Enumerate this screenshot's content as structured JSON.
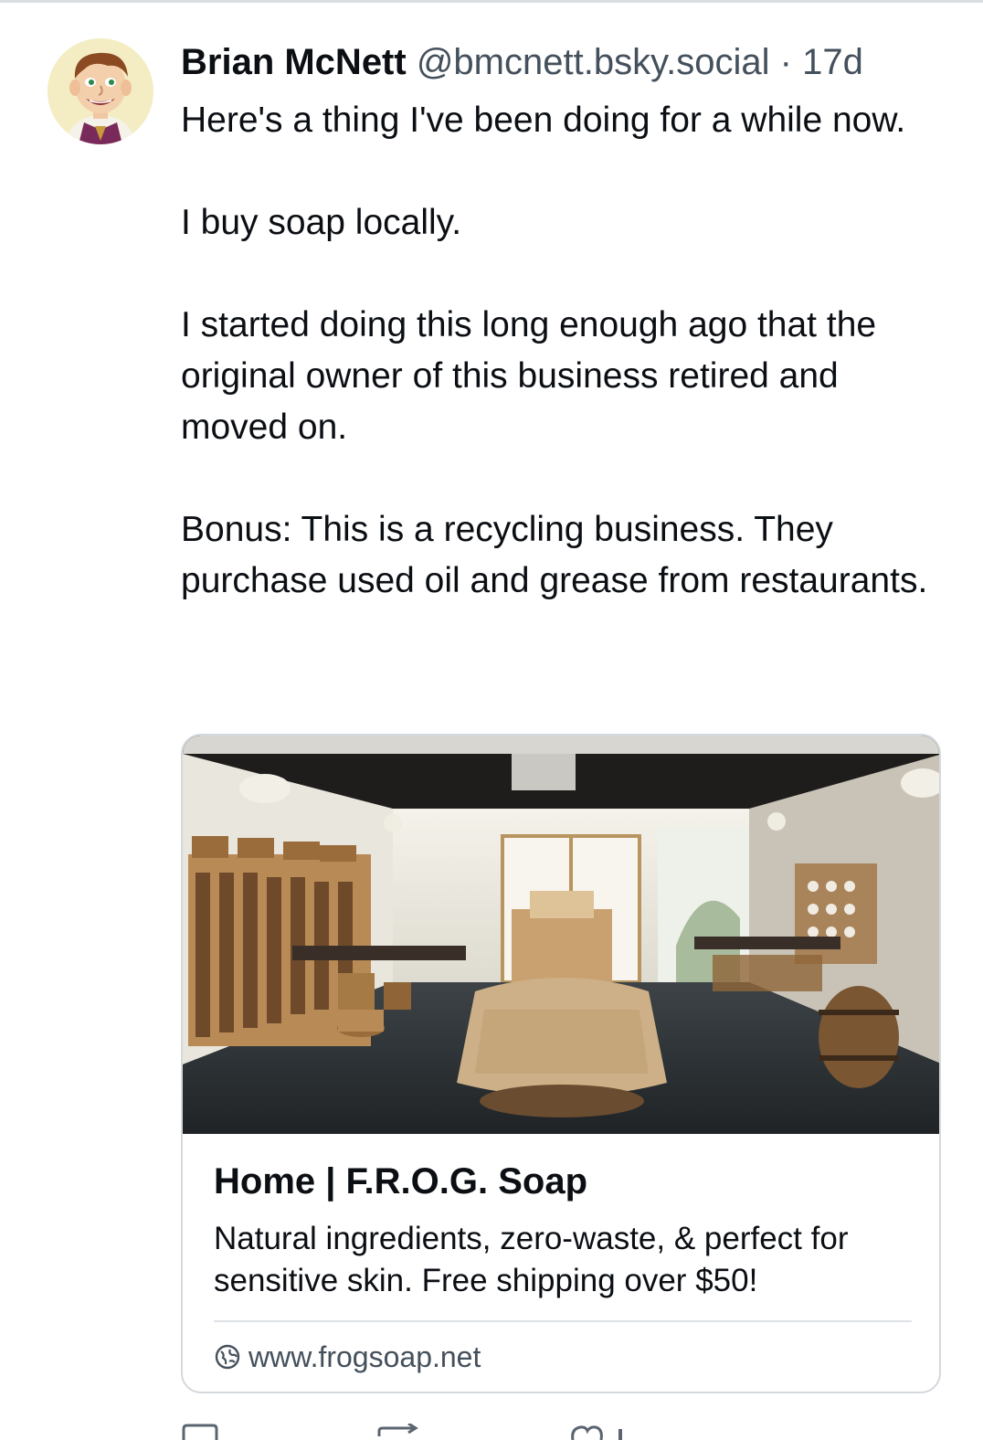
{
  "post": {
    "author_name": "Brian McNett",
    "author_handle": "@bmcnett.bsky.social",
    "separator": "·",
    "age": "17d",
    "paragraphs": [
      "Here's a thing I've been doing for a while now.",
      "I buy soap locally.",
      "I started doing this long enough ago that the original owner of this business retired and moved on.",
      "Bonus: This is a recycling business. They purchase used oil and grease from restaurants."
    ]
  },
  "link_card": {
    "title": "Home | F.R.O.G. Soap",
    "description": "Natural ingredients, zero-waste, & perfect for sensitive skin. Free shipping over $50!",
    "url": "www.frogsoap.net",
    "url_icon": "globe-icon"
  },
  "action_bar_icons": [
    "reply-icon",
    "repost-icon",
    "like-icon"
  ],
  "colors": {
    "text_primary": "#0b0f14",
    "text_secondary": "#44505c",
    "border": "#d4d9de"
  }
}
